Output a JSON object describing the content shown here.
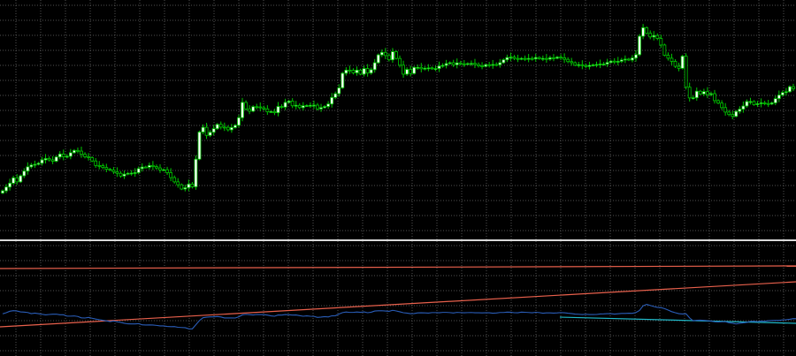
{
  "colors": {
    "background": "#000000",
    "grid": "#6e6e6e",
    "bull_body": "#ffffff",
    "bear_body": "#000000",
    "candle_wick": "#00c800",
    "separator": "#d8d8d8",
    "oscillator": "#2a5db8",
    "trendline_red": "#e8604c",
    "trendline_cyan": "#1fb8c8"
  },
  "chart_data": [
    {
      "type": "candlestick",
      "title": "",
      "xlabel": "",
      "ylabel": "",
      "grid": true,
      "ylim": [
        0,
        100
      ],
      "close": [
        18.1,
        19.8,
        21.5,
        23.9,
        22.1,
        24.8,
        26.9,
        28.8,
        29.6,
        29.9,
        30.4,
        31.9,
        32.5,
        31.9,
        31.3,
        33.2,
        34.5,
        33.3,
        33.5,
        35.1,
        36.1,
        35.8,
        34.4,
        33.3,
        32.9,
        31.4,
        29.4,
        29.3,
        28.5,
        27.7,
        27.4,
        26.6,
        25.9,
        24.7,
        25.5,
        25.9,
        26.0,
        26.2,
        28.0,
        28.7,
        28.6,
        29.4,
        28.9,
        28.3,
        27.4,
        27.5,
        26.2,
        24.0,
        22.1,
        20.8,
        18.9,
        19.5,
        21.1,
        19.9,
        32.2,
        44.3,
        46.4,
        42.8,
        44.2,
        45.8,
        47.7,
        46.5,
        46.4,
        45.3,
        46.3,
        47.3,
        50.7,
        57.5,
        54.6,
        53.6,
        55.6,
        55.5,
        55.1,
        54.6,
        53.3,
        53.4,
        52.9,
        55.7,
        55.4,
        57.5,
        58.1,
        56.0,
        56.2,
        55.2,
        56.0,
        56.1,
        56.2,
        56.3,
        54.6,
        55.2,
        55.7,
        56.8,
        59.7,
        61.4,
        64.0,
        70.5,
        71.9,
        71.8,
        70.7,
        71.9,
        70.1,
        72.6,
        70.6,
        72.1,
        75.2,
        78.7,
        79.8,
        78.4,
        76.5,
        80.1,
        77.1,
        74.1,
        70.1,
        72.2,
        70.4,
        73.1,
        73.1,
        72.5,
        72.7,
        72.9,
        72.5,
        72.6,
        73.7,
        74.0,
        74.8,
        75.2,
        74.3,
        75.1,
        74.7,
        74.6,
        74.8,
        74.9,
        74.4,
        73.8,
        73.6,
        74.3,
        74.1,
        74.4,
        74.3,
        75.2,
        76.5,
        77.5,
        77.7,
        77.1,
        76.8,
        77.1,
        77.0,
        77.1,
        76.9,
        77.5,
        77.0,
        77.1,
        76.8,
        77.4,
        77.2,
        77.7,
        77.4,
        76.7,
        75.7,
        75.2,
        74.1,
        74.3,
        73.9,
        73.5,
        74.0,
        74.2,
        74.4,
        74.6,
        74.6,
        75.3,
        75.9,
        75.6,
        75.8,
        76.4,
        76.8,
        76.4,
        77.3,
        78.8,
        87.0,
        90.8,
        88.3,
        86.7,
        87.3,
        86.0,
        83.1,
        78.5,
        77.2,
        75.8,
        73.6,
        72.7,
        78.1,
        64.3,
        59.5,
        59.6,
        62.5,
        61.3,
        62.3,
        61.0,
        61.4,
        58.3,
        57.2,
        55.2,
        53.2,
        52.1,
        51.3,
        53.5,
        54.5,
        55.9,
        57.9,
        57.9,
        56.5,
        56.9,
        57.3,
        57.0,
        56.8,
        57.3,
        59.2,
        60.8,
        61.9,
        62.3,
        64.5,
        63.6
      ],
      "series": [
        {
          "type": "line",
          "values": [
            36.2,
            37.3,
            38.7,
            39.2,
            38.9,
            38.1,
            37.9,
            37.5,
            36.4,
            36.9,
            36.4,
            35.8,
            35.2,
            35.6,
            35.9,
            35.9,
            35.3,
            35.3,
            34.0,
            34.0,
            34.2,
            33.7,
            32.4,
            32.2,
            32.8,
            32.0,
            31.2,
            30.6,
            30.0,
            29.5,
            28.8,
            29.4,
            28.6,
            28.0,
            27.2,
            26.6,
            26.5,
            26.5,
            26.8,
            25.7,
            25.5,
            25.6,
            25.5,
            25.1,
            24.6,
            24.6,
            24.1,
            23.9,
            24.0,
            23.3,
            23.1,
            22.9,
            21.9,
            21.8,
            25.7,
            29.8,
            32.5,
            33.0,
            33.3,
            33.3,
            33.6,
            33.2,
            32.3,
            32.3,
            32.3,
            32.2,
            33.4,
            35.2,
            35.7,
            35.4,
            35.1,
            35.6,
            35.5,
            35.4,
            35.0,
            34.3,
            33.9,
            35.1,
            35.0,
            35.5,
            35.3,
            35.0,
            35.1,
            34.5,
            33.9,
            34.3,
            33.9,
            33.8,
            32.8,
            33.1,
            33.5,
            33.2,
            34.3,
            34.4,
            36.0,
            37.4,
            38.0,
            37.6,
            37.6,
            38.0,
            37.7,
            38.1,
            37.3,
            37.8,
            38.9,
            39.1,
            39.2,
            38.9,
            38.6,
            39.6,
            39.0,
            38.2,
            37.3,
            36.9,
            36.4,
            36.5,
            37.1,
            37.2,
            37.1,
            36.9,
            37.4,
            37.4,
            37.2,
            37.6,
            37.6,
            37.4,
            37.0,
            37.6,
            37.4,
            37.2,
            37.4,
            37.5,
            37.2,
            37.2,
            37.1,
            37.2,
            37.2,
            36.8,
            37.0,
            37.5,
            37.5,
            37.9,
            37.8,
            37.3,
            37.2,
            37.9,
            37.7,
            37.5,
            37.2,
            37.7,
            37.4,
            36.8,
            37.1,
            37.1,
            36.9,
            37.1,
            37.4,
            37.2,
            36.8,
            36.5,
            36.0,
            35.8,
            35.5,
            35.8,
            35.5,
            35.5,
            35.6,
            36.1,
            36.2,
            36.4,
            36.4,
            36.0,
            36.3,
            36.6,
            36.6,
            36.8,
            36.7,
            37.5,
            39.4,
            43.9,
            45.3,
            44.3,
            43.2,
            42.4,
            42.2,
            41.2,
            39.8,
            38.3,
            37.3,
            36.4,
            36.1,
            36.3,
            32.3,
            29.5,
            30.0,
            30.1,
            29.9,
            29.6,
            29.3,
            28.6,
            28.4,
            28.6,
            28.7,
            27.7,
            27.3,
            26.5,
            27.2,
            27.6,
            28.0,
            29.0,
            29.1,
            28.7,
            29.3,
            29.1,
            29.6,
            29.8,
            29.9,
            29.9,
            30.4,
            30.6,
            31.0,
            31.6,
            31.5
          ]
        }
      ]
    }
  ]
}
